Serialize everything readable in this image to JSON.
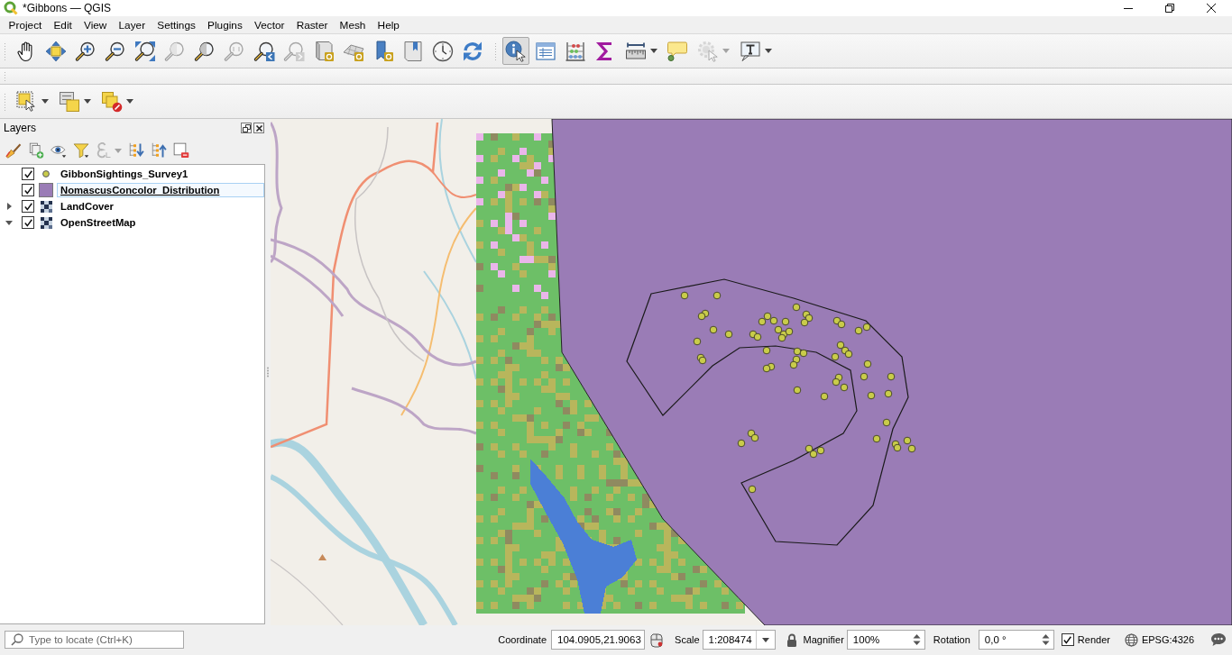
{
  "window": {
    "title": "*Gibbons — QGIS"
  },
  "menu": [
    "Project",
    "Edit",
    "View",
    "Layer",
    "Settings",
    "Plugins",
    "Vector",
    "Raster",
    "Mesh",
    "Help"
  ],
  "toolbars": [
    {
      "groups": [
        {
          "buttons": [
            {
              "kind": "pan",
              "disabled": false,
              "selected": false,
              "dropdown": false
            },
            {
              "kind": "pan-selection",
              "disabled": false,
              "selected": false,
              "dropdown": false
            },
            {
              "kind": "zoom-in",
              "disabled": false,
              "selected": false,
              "dropdown": false
            },
            {
              "kind": "zoom-out",
              "disabled": false,
              "selected": false,
              "dropdown": false
            },
            {
              "kind": "zoom-full",
              "disabled": false,
              "selected": false,
              "dropdown": false
            },
            {
              "kind": "zoom-selection",
              "disabled": true,
              "selected": false,
              "dropdown": false
            },
            {
              "kind": "zoom-layer",
              "disabled": false,
              "selected": false,
              "dropdown": false
            },
            {
              "kind": "zoom-native",
              "disabled": true,
              "selected": false,
              "dropdown": false
            },
            {
              "kind": "zoom-last",
              "disabled": false,
              "selected": false,
              "dropdown": false
            },
            {
              "kind": "zoom-next",
              "disabled": true,
              "selected": false,
              "dropdown": false
            },
            {
              "kind": "new-map-view",
              "disabled": false,
              "selected": false,
              "dropdown": false
            },
            {
              "kind": "new-3d-view",
              "disabled": false,
              "selected": false,
              "dropdown": false
            },
            {
              "kind": "new-bookmark",
              "disabled": false,
              "selected": false,
              "dropdown": false
            },
            {
              "kind": "bookmarks",
              "disabled": false,
              "selected": false,
              "dropdown": false
            },
            {
              "kind": "temporal",
              "disabled": false,
              "selected": false,
              "dropdown": false
            },
            {
              "kind": "refresh",
              "disabled": false,
              "selected": false,
              "dropdown": false
            }
          ]
        },
        {
          "buttons": [
            {
              "kind": "identify",
              "disabled": false,
              "selected": true,
              "dropdown": false
            },
            {
              "kind": "attribute-table",
              "disabled": false,
              "selected": false,
              "dropdown": false
            },
            {
              "kind": "statistics",
              "disabled": false,
              "selected": false,
              "dropdown": false
            },
            {
              "kind": "sum",
              "disabled": false,
              "selected": false,
              "dropdown": false
            },
            {
              "kind": "measure",
              "disabled": false,
              "selected": false,
              "dropdown": true
            },
            {
              "kind": "map-tips",
              "disabled": false,
              "selected": false,
              "dropdown": false
            },
            {
              "kind": "actions",
              "disabled": true,
              "selected": false,
              "dropdown": true
            },
            {
              "kind": "annotation",
              "disabled": false,
              "selected": false,
              "dropdown": true
            }
          ]
        }
      ]
    },
    {
      "groups": [
        {
          "buttons": [
            {
              "kind": "select",
              "disabled": false,
              "selected": false,
              "dropdown": true
            },
            {
              "kind": "select-attributes",
              "disabled": false,
              "selected": false,
              "dropdown": true
            },
            {
              "kind": "deselect",
              "disabled": false,
              "selected": false,
              "dropdown": true
            }
          ]
        }
      ]
    }
  ],
  "layers_panel": {
    "title": "Layers",
    "tools": [
      {
        "kind": "style",
        "disabled": false,
        "dropdown": false
      },
      {
        "kind": "add-group",
        "disabled": false,
        "dropdown": false
      },
      {
        "kind": "visibility",
        "disabled": false,
        "dropdown": false
      },
      {
        "kind": "filter",
        "disabled": false,
        "dropdown": false
      },
      {
        "kind": "expression",
        "disabled": true,
        "dropdown": true
      },
      {
        "kind": "expand-all",
        "disabled": false,
        "dropdown": false
      },
      {
        "kind": "collapse-all",
        "disabled": false,
        "dropdown": false
      },
      {
        "kind": "remove",
        "disabled": false,
        "dropdown": false
      }
    ],
    "layers": [
      {
        "name": "GibbonSightings_Survey1",
        "kind": "point",
        "color": "#c9cc4a",
        "checked": true,
        "selected": false
      },
      {
        "name": "NomascusConcolor_Distribution",
        "kind": "polygon",
        "color": "#9a7cb6",
        "checked": true,
        "selected": true
      },
      {
        "name": "LandCover",
        "kind": "raster",
        "checked": true,
        "selected": false,
        "expanded": false
      },
      {
        "name": "OpenStreetMap",
        "kind": "raster",
        "checked": true,
        "selected": false,
        "expanded": true
      }
    ]
  },
  "status_bar": {
    "locate": {
      "placeholder": "Type to locate (Ctrl+K)"
    },
    "coordinate": {
      "label": "Coordinate",
      "value": "104.0905,21.9063"
    },
    "scale": {
      "label": "Scale",
      "value": "1:208474"
    },
    "magnifier": {
      "label": "Magnifier",
      "value": "100%"
    },
    "rotation": {
      "label": "Rotation",
      "value": "0,0 °"
    },
    "render": {
      "label": "Render",
      "checked": true
    },
    "crs": "EPSG:4326"
  }
}
